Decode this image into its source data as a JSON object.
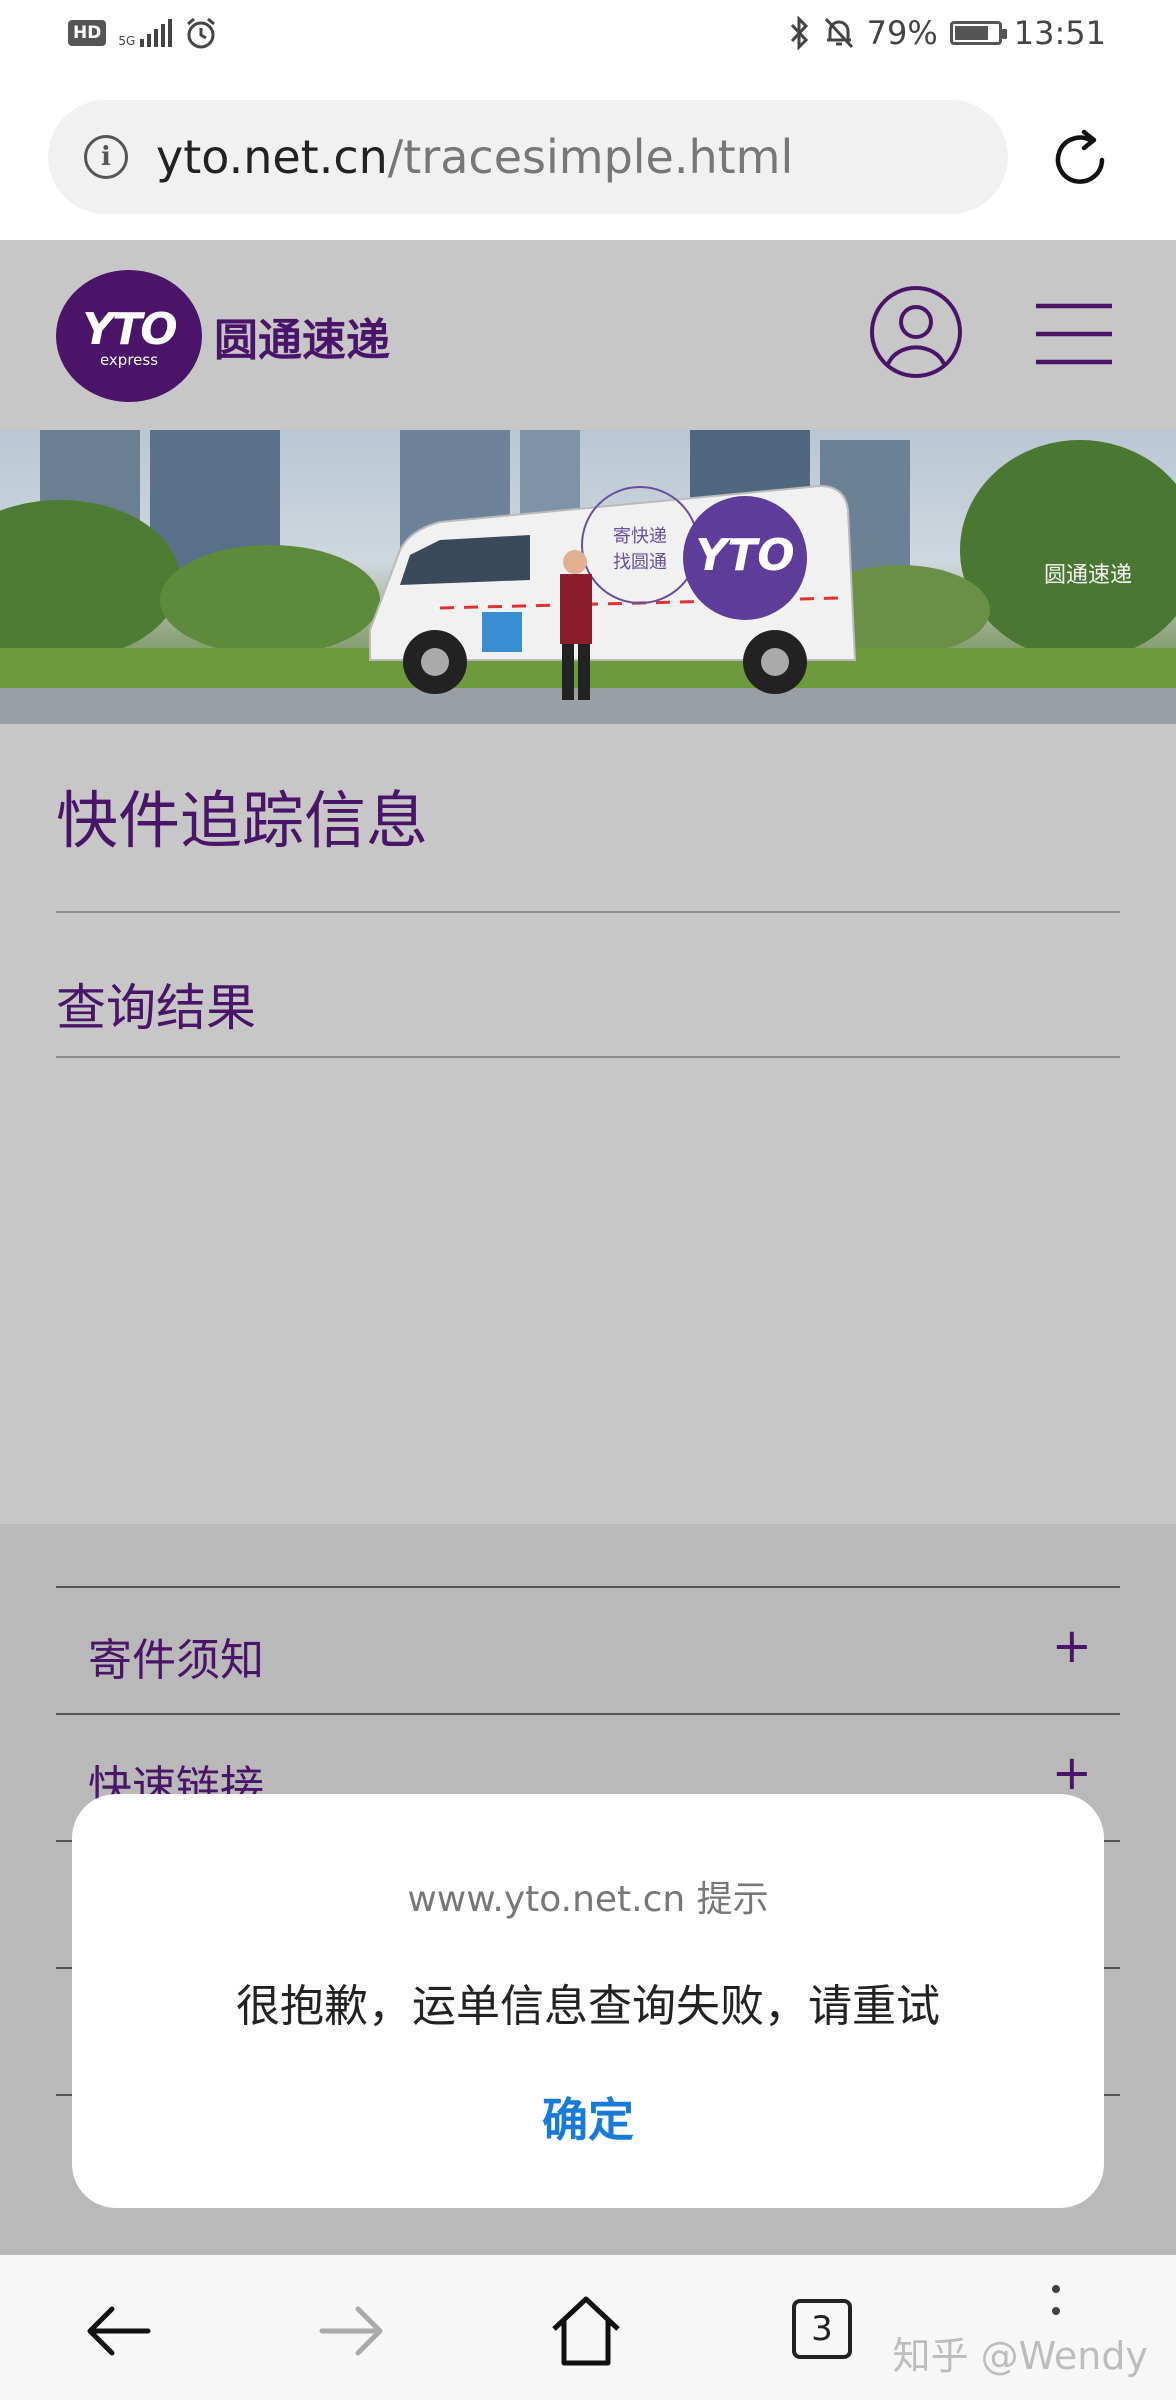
{
  "status_bar": {
    "hd": "HD",
    "network": "5G",
    "battery": "79%",
    "battery_level": 0.79,
    "time": "13:51"
  },
  "browser": {
    "url_host": "yto.net.cn",
    "url_path": "/tracesimple.html",
    "open_tabs": "3"
  },
  "site": {
    "logo_text": "YTO",
    "logo_sub": "express",
    "brand_name": "圆通速递",
    "banner_van_text_line1": "寄快递",
    "banner_van_text_line2": "找圆通",
    "banner_brand_caption": "圆通速递",
    "page_title": "快件追踪信息",
    "query_result": "查询结果",
    "accordion": [
      {
        "label": "寄件须知",
        "icon": "plus-icon"
      },
      {
        "label": "快速链接",
        "icon": "plus-icon"
      }
    ]
  },
  "dialog": {
    "title": "www.yto.net.cn 提示",
    "message": "很抱歉，运单信息查询失败，请重试",
    "ok_label": "确定"
  },
  "watermark": "知乎 @Wendy",
  "colors": {
    "brand_purple": "#4a1468",
    "brand_pink": "#e23aa7",
    "dialog_button": "#1a7ad8",
    "page_bg": "#c7c7c7"
  }
}
